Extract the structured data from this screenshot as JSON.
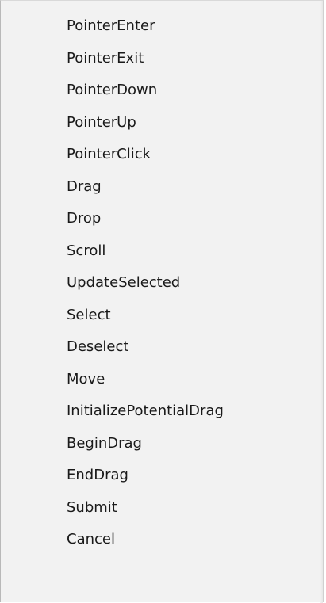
{
  "context_menu": {
    "items": [
      {
        "label": "PointerEnter"
      },
      {
        "label": "PointerExit"
      },
      {
        "label": "PointerDown"
      },
      {
        "label": "PointerUp"
      },
      {
        "label": "PointerClick"
      },
      {
        "label": "Drag"
      },
      {
        "label": "Drop"
      },
      {
        "label": "Scroll"
      },
      {
        "label": "UpdateSelected"
      },
      {
        "label": "Select"
      },
      {
        "label": "Deselect"
      },
      {
        "label": "Move"
      },
      {
        "label": "InitializePotentialDrag"
      },
      {
        "label": "BeginDrag"
      },
      {
        "label": "EndDrag"
      },
      {
        "label": "Submit"
      },
      {
        "label": "Cancel"
      }
    ]
  },
  "colors": {
    "background": "#f2f2f2",
    "text": "#1a1a1a",
    "border": "#b9b9b9"
  }
}
